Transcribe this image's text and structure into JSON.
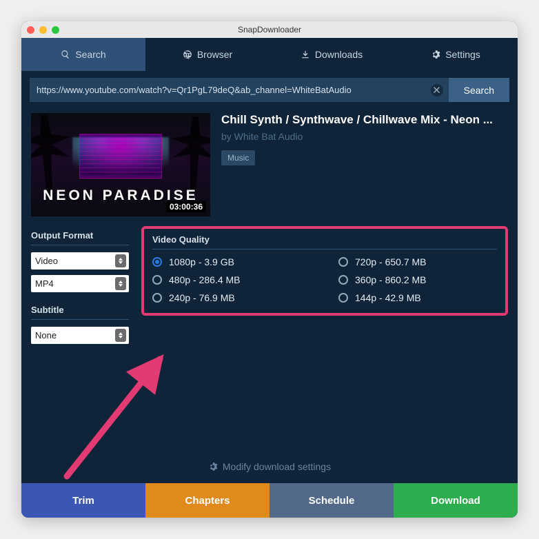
{
  "app_title": "SnapDownloader",
  "tabs": {
    "search": "Search",
    "browser": "Browser",
    "downloads": "Downloads",
    "settings": "Settings"
  },
  "search": {
    "url": "https://www.youtube.com/watch?v=Qr1PgL79deQ&ab_channel=WhiteBatAudio",
    "button": "Search"
  },
  "video": {
    "title": "Chill Synth / Synthwave / Chillwave Mix - Neon ...",
    "author": "by White Bat Audio",
    "tag": "Music",
    "duration": "03:00:36",
    "thumb_text": "NEON PARADISE"
  },
  "output_format": {
    "label": "Output Format",
    "type": "Video",
    "container": "MP4"
  },
  "subtitle": {
    "label": "Subtitle",
    "value": "None"
  },
  "quality": {
    "label": "Video Quality",
    "options": [
      "1080p - 3.9 GB",
      "720p - 650.7 MB",
      "480p - 286.4 MB",
      "360p - 860.2 MB",
      "240p - 76.9 MB",
      "144p - 42.9 MB"
    ],
    "selected_index": 0
  },
  "modify_link": "Modify download settings",
  "actions": {
    "trim": "Trim",
    "chapters": "Chapters",
    "schedule": "Schedule",
    "download": "Download"
  }
}
